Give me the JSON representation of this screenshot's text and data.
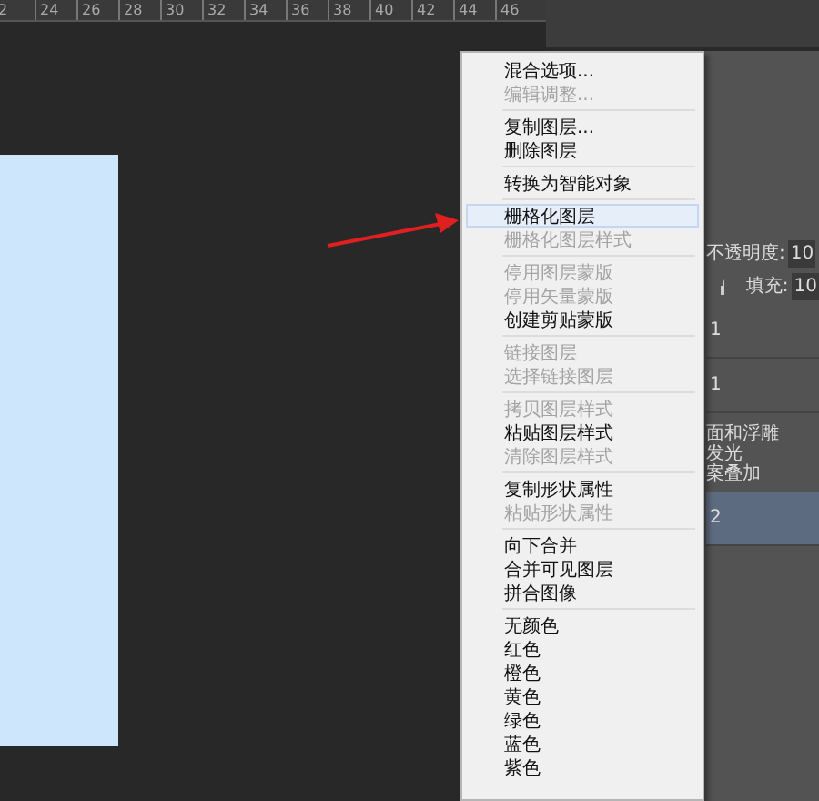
{
  "ruler": {
    "ticks": [
      "2",
      "24",
      "26",
      "28",
      "30",
      "32",
      "34",
      "36",
      "38",
      "40",
      "42",
      "44",
      "46"
    ]
  },
  "context_menu": {
    "sections": [
      {
        "items": [
          {
            "label": "混合选项...",
            "disabled": false,
            "selected": false
          },
          {
            "label": "编辑调整...",
            "disabled": true,
            "selected": false
          }
        ]
      },
      {
        "items": [
          {
            "label": "复制图层...",
            "disabled": false,
            "selected": false
          },
          {
            "label": "删除图层",
            "disabled": false,
            "selected": false
          }
        ]
      },
      {
        "items": [
          {
            "label": "转换为智能对象",
            "disabled": false,
            "selected": false
          }
        ]
      },
      {
        "items": [
          {
            "label": "栅格化图层",
            "disabled": false,
            "selected": true
          },
          {
            "label": "栅格化图层样式",
            "disabled": true,
            "selected": false
          }
        ]
      },
      {
        "items": [
          {
            "label": "停用图层蒙版",
            "disabled": true,
            "selected": false
          },
          {
            "label": "停用矢量蒙版",
            "disabled": true,
            "selected": false
          },
          {
            "label": "创建剪贴蒙版",
            "disabled": false,
            "selected": false
          }
        ]
      },
      {
        "items": [
          {
            "label": "链接图层",
            "disabled": true,
            "selected": false
          },
          {
            "label": "选择链接图层",
            "disabled": true,
            "selected": false
          }
        ]
      },
      {
        "items": [
          {
            "label": "拷贝图层样式",
            "disabled": true,
            "selected": false
          },
          {
            "label": "粘贴图层样式",
            "disabled": false,
            "selected": false
          },
          {
            "label": "清除图层样式",
            "disabled": true,
            "selected": false
          }
        ]
      },
      {
        "items": [
          {
            "label": "复制形状属性",
            "disabled": false,
            "selected": false
          },
          {
            "label": "粘贴形状属性",
            "disabled": true,
            "selected": false
          }
        ]
      },
      {
        "items": [
          {
            "label": "向下合并",
            "disabled": false,
            "selected": false
          },
          {
            "label": "合并可见图层",
            "disabled": false,
            "selected": false
          },
          {
            "label": "拼合图像",
            "disabled": false,
            "selected": false
          }
        ]
      },
      {
        "items": [
          {
            "label": "无颜色",
            "disabled": false,
            "selected": false
          },
          {
            "label": "红色",
            "disabled": false,
            "selected": false
          },
          {
            "label": "橙色",
            "disabled": false,
            "selected": false
          },
          {
            "label": "黄色",
            "disabled": false,
            "selected": false
          },
          {
            "label": "绿色",
            "disabled": false,
            "selected": false
          },
          {
            "label": "蓝色",
            "disabled": false,
            "selected": false
          },
          {
            "label": "紫色",
            "disabled": false,
            "selected": false
          }
        ]
      }
    ]
  },
  "layers_panel": {
    "opacity_label": "不透明度:",
    "opacity_value": "10",
    "fill_label": "填充:",
    "fill_value": "10",
    "layers": [
      {
        "name": "1",
        "kind": "layer",
        "selected": false
      },
      {
        "name": "1",
        "kind": "layer",
        "selected": false
      },
      {
        "name": "面和浮雕",
        "kind": "effect",
        "selected": false
      },
      {
        "name": "发光",
        "kind": "effect",
        "selected": false
      },
      {
        "name": "案叠加",
        "kind": "effect",
        "selected": false
      },
      {
        "name": "2",
        "kind": "layer",
        "selected": true
      }
    ]
  }
}
